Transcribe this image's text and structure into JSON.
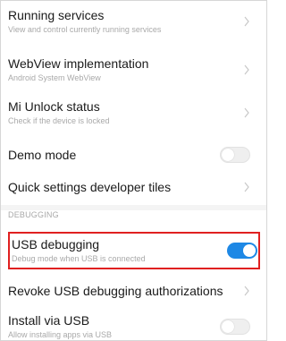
{
  "settings": {
    "rows": [
      {
        "title": "Running services",
        "subtitle": "View and control currently running services"
      },
      {
        "title": "WebView implementation",
        "subtitle": "Android System WebView"
      },
      {
        "title": "Mi Unlock status",
        "subtitle": "Check if the device is locked"
      },
      {
        "title": "Demo mode",
        "toggle": "off"
      },
      {
        "title": "Quick settings developer tiles"
      }
    ],
    "debugging_header": "DEBUGGING",
    "debugging_rows": [
      {
        "title": "USB debugging",
        "subtitle": "Debug mode when USB is connected",
        "toggle": "on"
      },
      {
        "title": "Revoke USB debugging authorizations"
      },
      {
        "title": "Install via USB",
        "subtitle": "Allow installing apps via USB",
        "toggle": "off"
      }
    ]
  },
  "colors": {
    "accent": "#1e88e5",
    "highlight": "#e02020",
    "title": "#1a1a1a",
    "subtitle": "#a9a9a9"
  }
}
